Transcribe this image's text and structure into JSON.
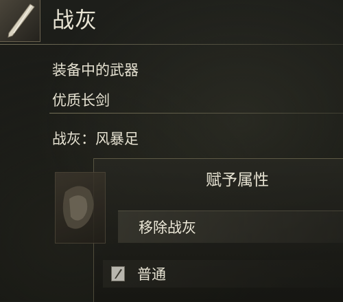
{
  "header": {
    "title": "战灰",
    "icon": "sword-icon"
  },
  "info": {
    "equipped_label": "装备中的武器",
    "weapon_name": "优质长剑",
    "ash_line": "战灰：风暴足"
  },
  "menu": {
    "heading": "赋予属性",
    "items": [
      {
        "label": "移除战灰"
      },
      {
        "label": "普通",
        "icon": "normal-affinity-icon"
      }
    ],
    "thumbnail_icon": "ash-of-war-icon"
  },
  "colors": {
    "text": "#e8e4d4",
    "background": "#151613",
    "accent": "#b8b6ae"
  }
}
